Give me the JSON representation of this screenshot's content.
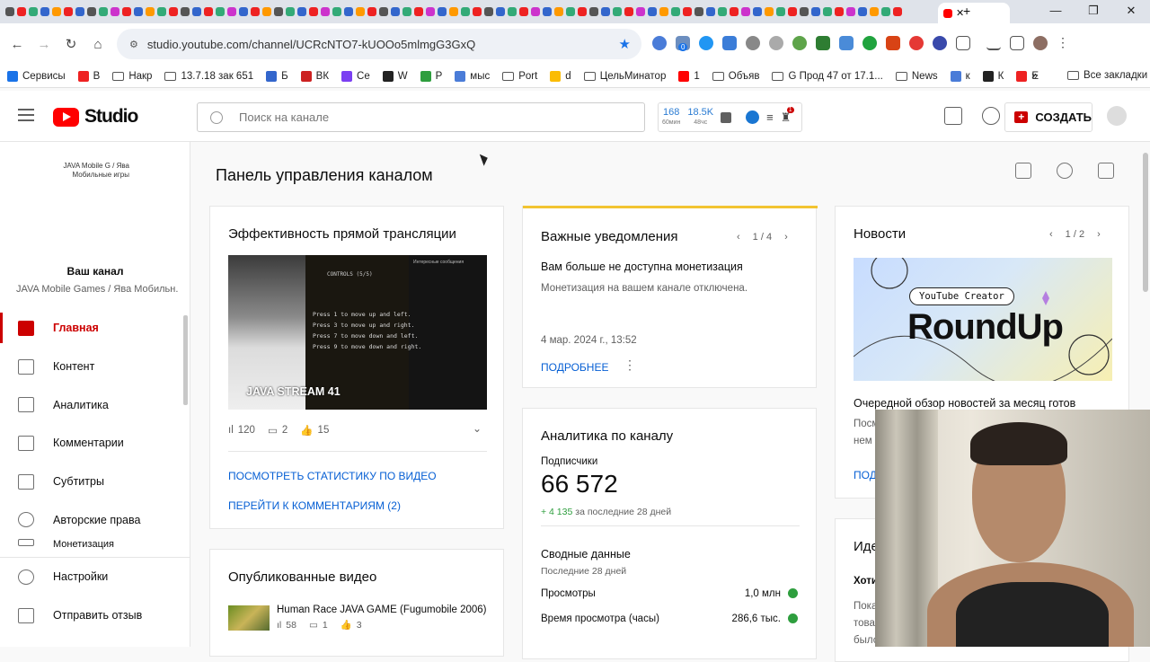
{
  "browser": {
    "url": "studio.youtube.com/channel/UCRcNTO7-kUOOo5mlmgG3GxQ",
    "window_controls": [
      "—",
      "❐",
      "✕"
    ],
    "bookmarks": [
      "Сервисы",
      "В",
      "Накр",
      "13.7.18 зак 651",
      "Б",
      "ВК",
      "Се",
      "W",
      "Р",
      "мыс",
      "Port",
      "d",
      "ЦельМинатор",
      "1",
      "Объяв",
      "G Прод 47 от 17.1...",
      "News",
      "к",
      "К",
      "Е"
    ],
    "all_bookmarks_label": "Все закладки",
    "extension_badge": "0"
  },
  "header": {
    "logo_text": "Studio",
    "search_placeholder": "Поиск на канале",
    "widget": {
      "views": "168",
      "views_sub": "60мин",
      "hours": "18.5K",
      "hours_sub": "48чс"
    },
    "notif_count": "1",
    "create_label": "СОЗДАТЬ"
  },
  "sidebar": {
    "thumb_text": "JAVA Mobile G / Ява Мобильные игры",
    "your_channel": "Ваш канал",
    "channel_name": "JAVA Mobile Games / Ява Мобильн...",
    "items": [
      {
        "label": "Главная",
        "icon": "dashboard-icon"
      },
      {
        "label": "Контент",
        "icon": "content-icon"
      },
      {
        "label": "Аналитика",
        "icon": "analytics-icon"
      },
      {
        "label": "Комментарии",
        "icon": "comments-icon"
      },
      {
        "label": "Субтитры",
        "icon": "subtitles-icon"
      },
      {
        "label": "Авторские права",
        "icon": "copyright-icon"
      },
      {
        "label": "Монетизация",
        "icon": "monetization-icon"
      }
    ],
    "bottom": [
      {
        "label": "Настройки",
        "icon": "gear-icon"
      },
      {
        "label": "Отправить отзыв",
        "icon": "feedback-icon"
      }
    ]
  },
  "main": {
    "page_title": "Панель управления каналом",
    "live_card": {
      "title": "Эффективность прямой трансляции",
      "thumb_caption": "JAVA STREAM 41",
      "thumb_controls": "CONTROLS (5/5)",
      "thumb_lines": [
        "Press 1 to move up and left.",
        "Press 3 to move up and right.",
        "Press 7 to move down and left.",
        "Press 9 to move down and right."
      ],
      "chat_title": "Интересные сообщения",
      "views": "120",
      "comments": "2",
      "likes": "15",
      "link_stats": "ПОСМОТРЕТЬ СТАТИСТИКУ ПО ВИДЕО",
      "link_comments": "ПЕРЕЙТИ К КОММЕНТАРИЯМ (2)"
    },
    "published_card": {
      "title": "Опубликованные видео",
      "video_title": "Human Race JAVA GAME (Fugumobile 2006)",
      "views": "58",
      "comments": "1",
      "likes": "3"
    },
    "notif_card": {
      "title": "Важные уведомления",
      "pager": "1 / 4",
      "heading": "Вам больше не доступна монетизация",
      "body": "Монетизация на вашем канале отключена.",
      "date": "4 мар. 2024 г., 13:52",
      "more": "ПОДРОБНЕЕ"
    },
    "analytics_card": {
      "title": "Аналитика по каналу",
      "subs_label": "Подписчики",
      "subs_value": "66 572",
      "subs_delta": "+ 4 135",
      "subs_period": "за последние 28 дней",
      "summary_title": "Сводные данные",
      "summary_period": "Последние 28 дней",
      "metrics": [
        {
          "label": "Просмотры",
          "value": "1,0 млн"
        },
        {
          "label": "Время просмотра (часы)",
          "value": "286,6 тыс."
        }
      ]
    },
    "news_card": {
      "title": "Новости",
      "pager": "1 / 2",
      "badge": "YouTube Creator",
      "image_title": "RoundUp",
      "headline": "Очередной обзор новостей за месяц готов",
      "body_1": "Посм",
      "body_2": "нем с",
      "link": "ПОД"
    },
    "ideas_card": {
      "title": "Иде",
      "line1": "Хоти",
      "line2": "Пока",
      "line3": "това",
      "line4": "было"
    }
  },
  "colors": {
    "accent": "#cc0000",
    "link": "#065fd4",
    "notif_bar": "#f2c432"
  }
}
